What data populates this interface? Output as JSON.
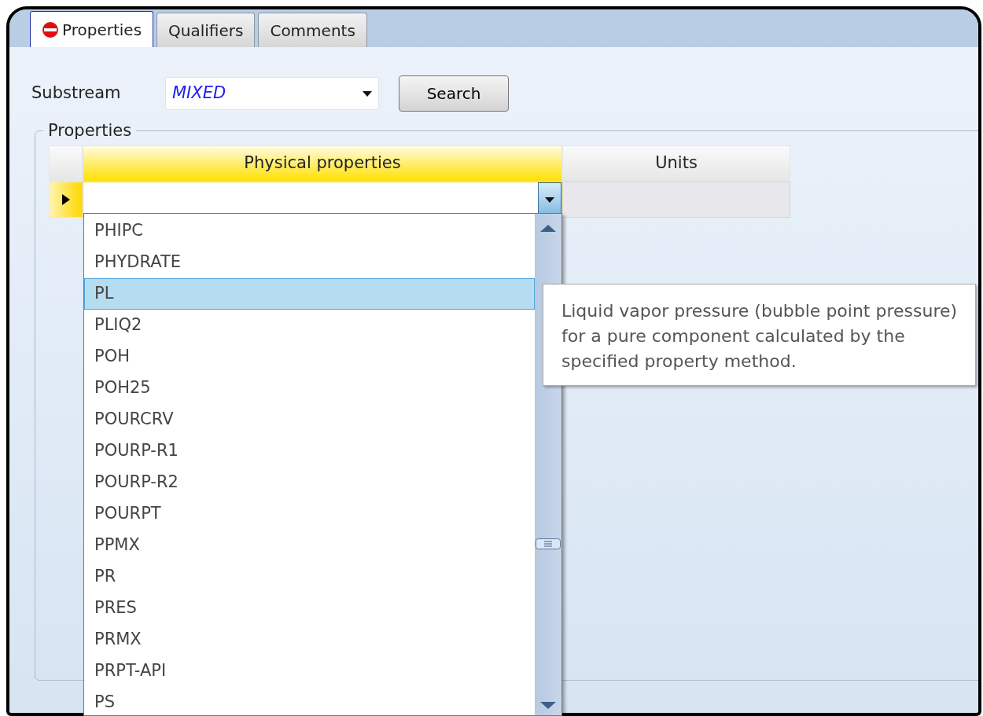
{
  "tabs": [
    {
      "label": "Properties",
      "selected": true,
      "warning_icon": true
    },
    {
      "label": "Qualifiers",
      "selected": false
    },
    {
      "label": "Comments",
      "selected": false
    }
  ],
  "substream": {
    "label": "Substream",
    "value": "MIXED"
  },
  "search_button": "Search",
  "group": {
    "title": "Properties"
  },
  "grid": {
    "columns": [
      "Physical properties",
      "Units"
    ],
    "current_row": {
      "selected": true
    }
  },
  "dropdown": {
    "items": [
      {
        "label": "PHIPC",
        "selected": false
      },
      {
        "label": "PHYDRATE",
        "selected": false
      },
      {
        "label": "PL",
        "selected": true
      },
      {
        "label": "PLIQ2",
        "selected": false
      },
      {
        "label": "POH",
        "selected": false
      },
      {
        "label": "POH25",
        "selected": false
      },
      {
        "label": "POURCRV",
        "selected": false
      },
      {
        "label": "POURP-R1",
        "selected": false
      },
      {
        "label": "POURP-R2",
        "selected": false
      },
      {
        "label": "POURPT",
        "selected": false
      },
      {
        "label": "PPMX",
        "selected": false
      },
      {
        "label": "PR",
        "selected": false
      },
      {
        "label": "PRES",
        "selected": false
      },
      {
        "label": "PRMX",
        "selected": false
      },
      {
        "label": "PRPT-API",
        "selected": false
      },
      {
        "label": "PS",
        "selected": false
      }
    ]
  },
  "tooltip": "Liquid vapor pressure (bubble point pressure) for a pure component calculated by the specified property method."
}
